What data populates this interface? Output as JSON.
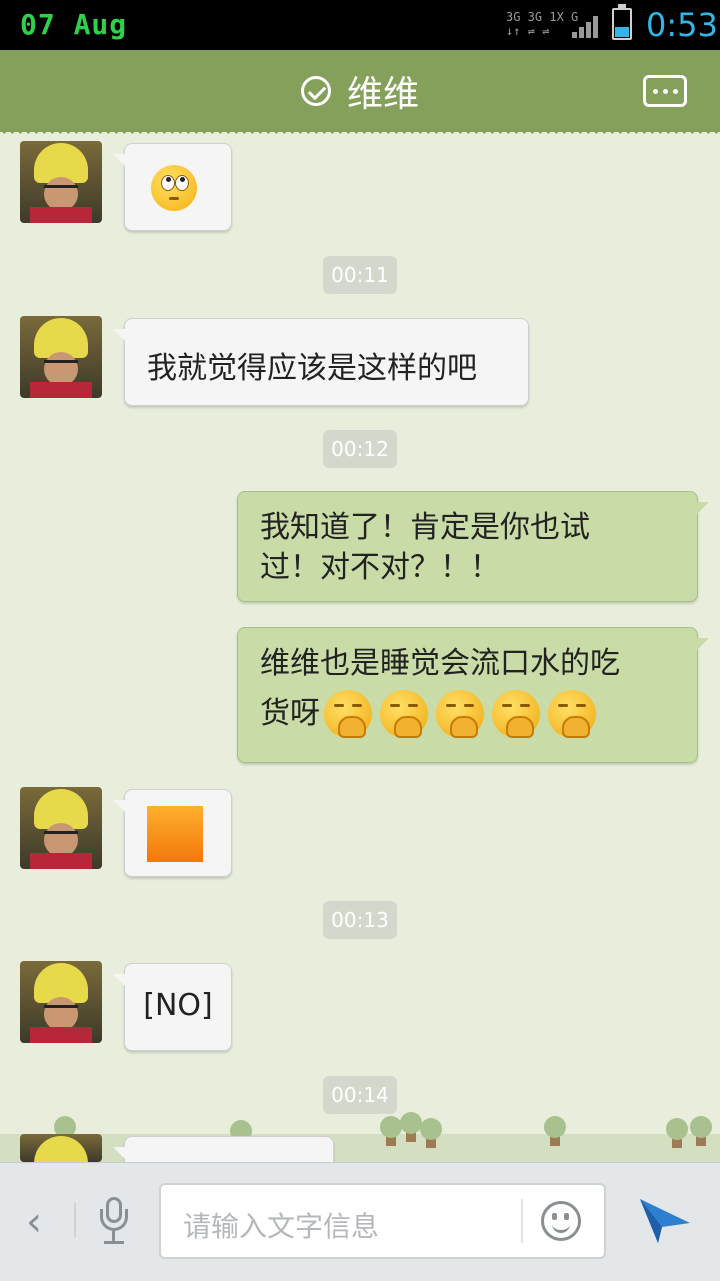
{
  "status_bar": {
    "date": "07 Aug",
    "network_top": "3G 3G 1X G",
    "network_bottom": "↓↑ ⇌ ⇌",
    "time": "0:53",
    "battery_level": 0.35
  },
  "header": {
    "title": "维维"
  },
  "messages": [
    {
      "type": "emoji",
      "side": "left",
      "content": "rolling-eyes-emoji"
    },
    {
      "type": "time",
      "text": "00:11"
    },
    {
      "type": "text",
      "side": "left",
      "text": "我就觉得应该是这样的吧"
    },
    {
      "type": "time",
      "text": "00:12"
    },
    {
      "type": "text",
      "side": "right",
      "line1": "我知道了！肯定是你也试",
      "line2": "过！对不对？！！"
    },
    {
      "type": "text",
      "side": "right",
      "line1": "维维也是睡觉会流口水的吃",
      "line2": "货呀",
      "emoji_count": 5,
      "emoji": "yawn-emoji"
    },
    {
      "type": "image",
      "side": "left",
      "content": "orange-square"
    },
    {
      "type": "time",
      "text": "00:13"
    },
    {
      "type": "text",
      "side": "left",
      "text": "[NO]"
    },
    {
      "type": "time",
      "text": "00:14"
    }
  ],
  "input_bar": {
    "placeholder": "请输入文字信息",
    "back_icon": "‹"
  },
  "colors": {
    "header": "#84a05a",
    "chat_background": "#e8eedb",
    "sent_bubble": "#c9dba6",
    "received_bubble": "#f5f5f5",
    "status_time": "#33b5e5",
    "status_date": "#2fd14b",
    "send_icon": "#2f7fd0"
  }
}
